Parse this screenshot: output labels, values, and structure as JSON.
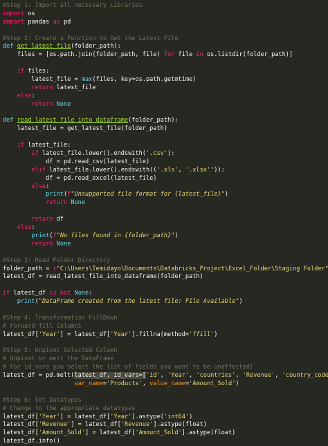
{
  "theme": {
    "background": "#272822",
    "foreground": "#f8f8f2",
    "comment": "#75715e",
    "keyword": "#f92672",
    "builtin": "#66d9ef",
    "function": "#a6e22e",
    "string": "#e6db74",
    "number": "#ae81ff",
    "param": "#fd971f",
    "selection": "#49483e"
  },
  "lines": [
    [
      [
        "c",
        "#Step 1: Import all necessary Libraries"
      ]
    ],
    [
      [
        "k",
        "import"
      ],
      [
        "t",
        " os"
      ]
    ],
    [
      [
        "k",
        "import"
      ],
      [
        "t",
        " pandas "
      ],
      [
        "k",
        "as"
      ],
      [
        "t",
        " pd"
      ]
    ],
    [],
    [
      [
        "c",
        "#Step 2: Create a Function to Get the Latest File"
      ]
    ],
    [
      [
        "b",
        "def"
      ],
      [
        "t",
        " "
      ],
      [
        "f",
        "get_latest_file"
      ],
      [
        "t",
        "(folder_path):"
      ]
    ],
    [
      [
        "t",
        "    files = [os.path.join(folder_path, file) "
      ],
      [
        "k",
        "for"
      ],
      [
        "t",
        " file "
      ],
      [
        "k",
        "in"
      ],
      [
        "t",
        " os.listdir(folder_path)]"
      ]
    ],
    [],
    [
      [
        "t",
        "    "
      ],
      [
        "k",
        "if"
      ],
      [
        "t",
        " files:"
      ]
    ],
    [
      [
        "t",
        "        latest_file = "
      ],
      [
        "b",
        "max"
      ],
      [
        "t",
        "(files, key=os.path.getmtime)"
      ]
    ],
    [
      [
        "t",
        "        "
      ],
      [
        "k",
        "return"
      ],
      [
        "t",
        " latest_file"
      ]
    ],
    [
      [
        "t",
        "    "
      ],
      [
        "k",
        "else"
      ],
      [
        "t",
        ":"
      ]
    ],
    [
      [
        "t",
        "        "
      ],
      [
        "k",
        "return"
      ],
      [
        "t",
        " "
      ],
      [
        "b",
        "None"
      ]
    ],
    [],
    [
      [
        "b",
        "def"
      ],
      [
        "t",
        " "
      ],
      [
        "f",
        "read_latest_file_into_dataframe"
      ],
      [
        "t",
        "(folder_path):"
      ]
    ],
    [
      [
        "t",
        "    latest_file = get_latest_file(folder_path)"
      ]
    ],
    [],
    [
      [
        "t",
        "    "
      ],
      [
        "k",
        "if"
      ],
      [
        "t",
        " latest_file:"
      ]
    ],
    [
      [
        "t",
        "        "
      ],
      [
        "k",
        "if"
      ],
      [
        "t",
        " latest_file.lower().endswith("
      ],
      [
        "s",
        "'.csv'"
      ],
      [
        "t",
        "):"
      ]
    ],
    [
      [
        "t",
        "            df = pd.read_csv(latest_file)"
      ]
    ],
    [
      [
        "t",
        "        "
      ],
      [
        "k",
        "elif"
      ],
      [
        "t",
        " latest_file.lower().endswith(("
      ],
      [
        "s",
        "'.xls'"
      ],
      [
        "t",
        ", "
      ],
      [
        "s",
        "'.xlsx'"
      ],
      [
        "t",
        "')):"
      ]
    ],
    [
      [
        "t",
        "            df = pd.read_excel(latest_file)"
      ]
    ],
    [
      [
        "t",
        "        "
      ],
      [
        "k",
        "else"
      ],
      [
        "t",
        ":"
      ]
    ],
    [
      [
        "t",
        "            "
      ],
      [
        "b",
        "print"
      ],
      [
        "t",
        "("
      ],
      [
        "k",
        "f"
      ],
      [
        "s",
        "\"Unsupported file format for {latest_file}\""
      ],
      [
        "t",
        ")"
      ]
    ],
    [
      [
        "t",
        "            "
      ],
      [
        "k",
        "return"
      ],
      [
        "t",
        " "
      ],
      [
        "b",
        "None"
      ]
    ],
    [],
    [
      [
        "t",
        "        "
      ],
      [
        "k",
        "return"
      ],
      [
        "t",
        " df"
      ]
    ],
    [
      [
        "t",
        "    "
      ],
      [
        "k",
        "else"
      ],
      [
        "t",
        ":"
      ]
    ],
    [
      [
        "t",
        "        "
      ],
      [
        "b",
        "print"
      ],
      [
        "t",
        "("
      ],
      [
        "k",
        "f"
      ],
      [
        "s",
        "\"No files found in {folder_path}\""
      ],
      [
        "t",
        ")"
      ]
    ],
    [
      [
        "t",
        "        "
      ],
      [
        "k",
        "return"
      ],
      [
        "t",
        " "
      ],
      [
        "b",
        "None"
      ]
    ],
    [],
    [
      [
        "c",
        "#Step 3: Read Folder Directory"
      ]
    ],
    [
      [
        "t",
        "folder_path = "
      ],
      [
        "k",
        "r"
      ],
      [
        "s",
        "\"C:\\Users\\Temidayo\\Documents\\Databricks_Project\\Excel_Folder\\Staging Folder\""
      ]
    ],
    [
      [
        "t",
        "latest_df = read_latest_file_into_dataframe(folder_path)"
      ]
    ],
    [],
    [
      [
        "k",
        "if"
      ],
      [
        "t",
        " latest_df "
      ],
      [
        "k",
        "is not"
      ],
      [
        "t",
        " "
      ],
      [
        "b",
        "None"
      ],
      [
        "t",
        ":"
      ]
    ],
    [
      [
        "t",
        "    "
      ],
      [
        "b",
        "print"
      ],
      [
        "t",
        "("
      ],
      [
        "s",
        "\"DataFrame created from the latest file: File Available\""
      ],
      [
        "t",
        ")"
      ]
    ],
    [],
    [
      [
        "c",
        "#Step 4: Transformation FillDown"
      ]
    ],
    [
      [
        "c",
        "# Forward fill Column1"
      ]
    ],
    [
      [
        "t",
        "latest_df["
      ],
      [
        "s",
        "'Year'"
      ],
      [
        "t",
        "] = latest_df["
      ],
      [
        "s",
        "'Year'"
      ],
      [
        "t",
        "].fillna(method="
      ],
      [
        "s",
        "'ffill'"
      ],
      [
        "t",
        ")"
      ]
    ],
    [],
    [
      [
        "c",
        "#Step 5: Unpivot Selected Column"
      ]
    ],
    [
      [
        "c",
        "# Unpivot or melt the DataFrame"
      ]
    ],
    [
      [
        "c",
        "# For id_vars you select the list of fields you want to be unaffected!"
      ]
    ],
    [
      [
        "t",
        "latest_df = pd.melt("
      ],
      [
        "sel",
        "latest_df, id_vars=["
      ],
      [
        "s",
        "'id'"
      ],
      [
        "t",
        ", "
      ],
      [
        "s",
        "'Year'"
      ],
      [
        "t",
        ", "
      ],
      [
        "s",
        "'countries'"
      ],
      [
        "t",
        ", "
      ],
      [
        "s",
        "'Revenue'"
      ],
      [
        "t",
        ", "
      ],
      [
        "s",
        "'country_code'"
      ],
      [
        "t",
        "],"
      ]
    ],
    [
      [
        "t",
        "                    "
      ],
      [
        "p",
        "var_name"
      ],
      [
        "t",
        "="
      ],
      [
        "s",
        "'Products'"
      ],
      [
        "t",
        ", "
      ],
      [
        "p",
        "value_name"
      ],
      [
        "t",
        "="
      ],
      [
        "s",
        "'Amount_Sold'"
      ],
      [
        "t",
        ")"
      ]
    ],
    [],
    [
      [
        "c",
        "#Step 6: Set Datatypes"
      ]
    ],
    [
      [
        "c",
        "# Change to the appropriate datatypes"
      ]
    ],
    [
      [
        "t",
        "latest_df["
      ],
      [
        "s",
        "'Year'"
      ],
      [
        "t",
        "] = latest_df["
      ],
      [
        "s",
        "'Year'"
      ],
      [
        "t",
        "].astype("
      ],
      [
        "s",
        "'int64'"
      ],
      [
        "t",
        ")"
      ]
    ],
    [
      [
        "t",
        "latest_df["
      ],
      [
        "s",
        "'Revenue'"
      ],
      [
        "t",
        "] = latest_df["
      ],
      [
        "s",
        "'Revenue'"
      ],
      [
        "t",
        "].astype(float)"
      ]
    ],
    [
      [
        "t",
        "latest_df["
      ],
      [
        "s",
        "'Amount_Sold'"
      ],
      [
        "t",
        "] = latest_df["
      ],
      [
        "s",
        "'Amount_Sold'"
      ],
      [
        "t",
        "].astype(float)"
      ]
    ],
    [
      [
        "t",
        "latest_df.info()"
      ]
    ]
  ]
}
